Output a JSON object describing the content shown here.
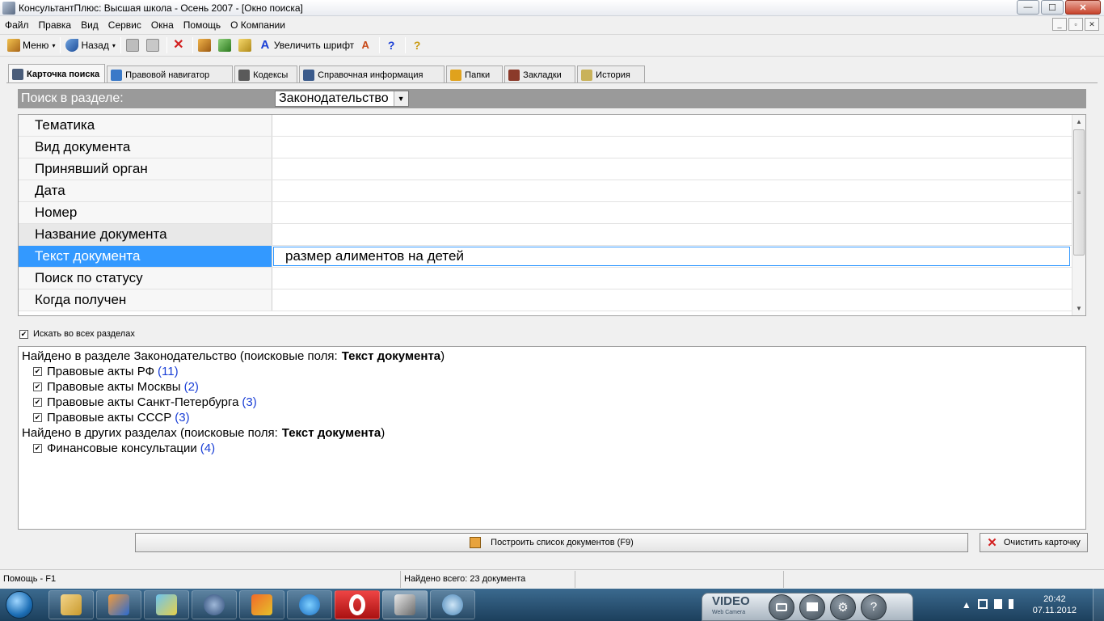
{
  "window": {
    "title": "КонсультантПлюс: Высшая школа - Осень 2007 - [Окно поиска]",
    "min_glyph": "—",
    "max_glyph": "☐",
    "close_glyph": "✕"
  },
  "menu": [
    "Файл",
    "Правка",
    "Вид",
    "Сервис",
    "Окна",
    "Помощь",
    "О Компании"
  ],
  "mdi": {
    "min": "_",
    "restore": "▫",
    "close": "✕"
  },
  "toolbar": {
    "menu_label": "Меню",
    "back_label": "Назад",
    "font_label": "Увеличить шрифт",
    "caret": "▾",
    "font_icon_glyph": "A",
    "help_glyph": "?"
  },
  "tabs": [
    {
      "label": "Карточка поиска",
      "icon_color": "#4a5d7a"
    },
    {
      "label": "Правовой навигатор",
      "icon_color": "#3a79c8"
    },
    {
      "label": "Кодексы",
      "icon_color": "#5a5a5a"
    },
    {
      "label": "Справочная информация",
      "icon_color": "#3b5b8c"
    },
    {
      "label": "Папки",
      "icon_color": "#e0a21d"
    },
    {
      "label": "Закладки",
      "icon_color": "#8b3a2a"
    },
    {
      "label": "История",
      "icon_color": "#c9b25a"
    }
  ],
  "section": {
    "label": "Поиск в разделе:",
    "value": "Законодательство",
    "dropdown_glyph": "▼"
  },
  "fields": [
    {
      "name": "Тематика",
      "value": ""
    },
    {
      "name": "Вид документа",
      "value": ""
    },
    {
      "name": "Принявший орган",
      "value": ""
    },
    {
      "name": "Дата",
      "value": ""
    },
    {
      "name": "Номер",
      "value": ""
    },
    {
      "name": "Название документа",
      "value": ""
    },
    {
      "name": "Текст документа",
      "value": "размер алиментов на детей"
    },
    {
      "name": "Поиск по статусу",
      "value": ""
    },
    {
      "name": "Когда получен",
      "value": ""
    }
  ],
  "scroll": {
    "up": "▲",
    "down": "▼",
    "grip": "≡"
  },
  "search_all": {
    "checked": true,
    "check_glyph": "✔",
    "label": "Искать во всех разделах"
  },
  "results": {
    "group1": {
      "prefix": "Найдено в разделе Законодательство (поисковые поля:",
      "field": "Текст документа",
      "suffix": ")"
    },
    "items1": [
      {
        "label": "Правовые акты РФ",
        "count": "(11)"
      },
      {
        "label": "Правовые акты Москвы",
        "count": "(2)"
      },
      {
        "label": "Правовые акты Санкт-Петербурга",
        "count": "(3)"
      },
      {
        "label": "Правовые акты СССР",
        "count": "(3)"
      }
    ],
    "group2": {
      "prefix": "Найдено в других разделах (поисковые поля:",
      "field": "Текст документа",
      "suffix": ")"
    },
    "items2": [
      {
        "label": "Финансовые консультации",
        "count": "(4)"
      }
    ]
  },
  "buttons": {
    "build": "Построить список документов (F9)",
    "clear": "Очистить карточку",
    "clear_glyph": "✕"
  },
  "status": {
    "help": "Помощь - F1",
    "found": "Найдено всего: 23 документа"
  },
  "taskbar": {
    "camera_brand": "VIDEO",
    "camera_sub": "Web Camera",
    "camera_help": "?",
    "camera_gear": "⚙",
    "tray_up": "▲",
    "time": "20:42",
    "date": "07.11.2012"
  }
}
